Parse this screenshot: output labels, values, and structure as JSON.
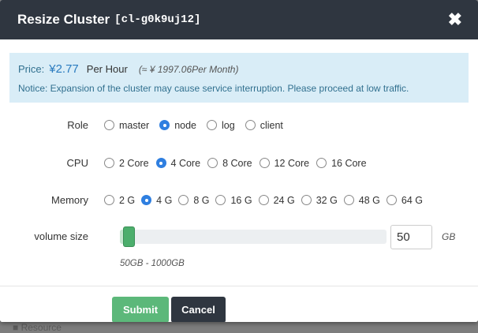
{
  "dialog": {
    "title": "Resize Cluster",
    "cluster_id": "[cl-g0k9uj12]",
    "close_symbol": "✖"
  },
  "notice": {
    "price_label": "Price:",
    "price_value": "¥2.77",
    "price_unit": "Per Hour",
    "price_month": "(≈ ¥ 1997.06Per Month)",
    "message": "Notice: Expansion of the cluster may cause service interruption. Please proceed at low traffic."
  },
  "role": {
    "label": "Role",
    "options": [
      "master",
      "node",
      "log",
      "client"
    ],
    "selected": "node"
  },
  "cpu": {
    "label": "CPU",
    "options": [
      "2 Core",
      "4 Core",
      "8 Core",
      "12 Core",
      "16 Core"
    ],
    "selected": "4 Core"
  },
  "memory": {
    "label": "Memory",
    "options": [
      "2 G",
      "4 G",
      "8 G",
      "16 G",
      "24 G",
      "32 G",
      "48 G",
      "64 G"
    ],
    "selected": "4 G"
  },
  "volume": {
    "label": "volume size",
    "value": "50",
    "unit": "GB",
    "min": 50,
    "max": 1000,
    "hint": "50GB - 1000GB"
  },
  "footer": {
    "submit_label": "Submit",
    "cancel_label": "Cancel"
  },
  "colors": {
    "header_bg": "#2f3640",
    "notice_bg": "#d9edf7",
    "accent_radio": "#2f7fe0",
    "submit_bg": "#5cb87a",
    "slider_handle": "#4cae6c"
  }
}
